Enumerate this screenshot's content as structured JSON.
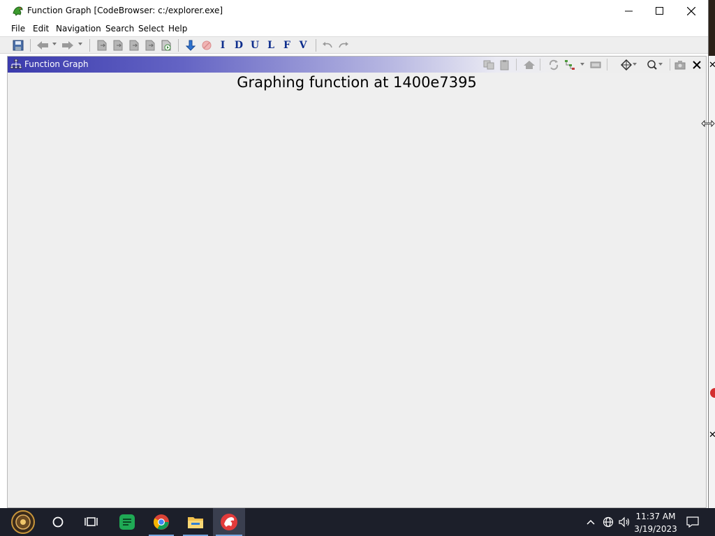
{
  "window": {
    "title": "Function Graph [CodeBrowser: c:/explorer.exe]"
  },
  "menu": {
    "items": [
      "File",
      "Edit",
      "Navigation",
      "Search",
      "Select",
      "Help"
    ]
  },
  "toolbar": {
    "letters": [
      "I",
      "D",
      "U",
      "L",
      "F",
      "V"
    ]
  },
  "panel": {
    "title": "Function Graph",
    "message": "Graphing function at 1400e7395"
  },
  "taskbar": {
    "time": "11:37 AM",
    "date": "3/19/2023"
  },
  "colors": {
    "panel_header_start": "#3b3bad",
    "panel_background": "#efefef",
    "taskbar": "#1c1f2a",
    "letter_icons": "#0d2d8c"
  }
}
